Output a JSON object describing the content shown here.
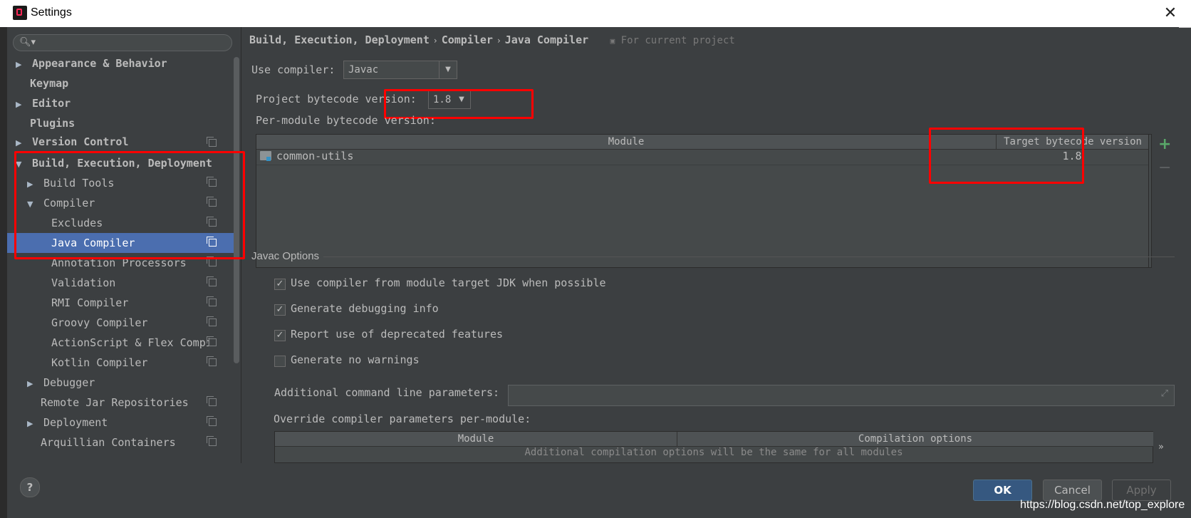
{
  "window": {
    "title": "Settings"
  },
  "search": {
    "placeholder": ""
  },
  "sidebar": {
    "items": [
      {
        "label": "Appearance & Behavior"
      },
      {
        "label": "Keymap"
      },
      {
        "label": "Editor"
      },
      {
        "label": "Plugins"
      },
      {
        "label": "Version Control"
      },
      {
        "label": "Build, Execution, Deployment"
      },
      {
        "label": "Build Tools"
      },
      {
        "label": "Compiler"
      },
      {
        "label": "Excludes"
      },
      {
        "label": "Java Compiler"
      },
      {
        "label": "Annotation Processors"
      },
      {
        "label": "Validation"
      },
      {
        "label": "RMI Compiler"
      },
      {
        "label": "Groovy Compiler"
      },
      {
        "label": "ActionScript & Flex Compi"
      },
      {
        "label": "Kotlin Compiler"
      },
      {
        "label": "Debugger"
      },
      {
        "label": "Remote Jar Repositories"
      },
      {
        "label": "Deployment"
      },
      {
        "label": "Arquillian Containers"
      }
    ]
  },
  "breadcrumb": {
    "parts": [
      "Build, Execution, Deployment",
      "Compiler",
      "Java Compiler"
    ],
    "hint": "For current project"
  },
  "compiler": {
    "use_label": "Use compiler:",
    "use_value": "Javac",
    "bytecode_label": "Project bytecode version:",
    "bytecode_value": "1.8",
    "per_module_label": "Per-module bytecode version:"
  },
  "module_table": {
    "headers": [
      "Module",
      "Target bytecode version"
    ],
    "rows": [
      {
        "module": "common-utils",
        "target": "1.8"
      }
    ]
  },
  "javac_options": {
    "title": "Javac Options",
    "checkboxes": [
      {
        "label": "Use compiler from module target JDK when possible",
        "checked": "✓"
      },
      {
        "label": "Generate debugging info",
        "checked": "✓"
      },
      {
        "label": "Report use of deprecated features",
        "checked": "✓"
      },
      {
        "label": "Generate no warnings",
        "checked": ""
      }
    ],
    "additional_label": "Additional command line parameters:",
    "additional_value": "",
    "override_label": "Override compiler parameters per-module:",
    "override_headers": [
      "Module",
      "Compilation options"
    ],
    "override_empty": "Additional compilation options will be the same for all modules"
  },
  "buttons": {
    "ok": "OK",
    "cancel": "Cancel",
    "apply": "Apply",
    "help": "?"
  },
  "watermark": "https://blog.csdn.net/top_explore",
  "colors": {
    "selection": "#4b6eaf",
    "highlight": "#ff0000",
    "add": "#59a869"
  }
}
